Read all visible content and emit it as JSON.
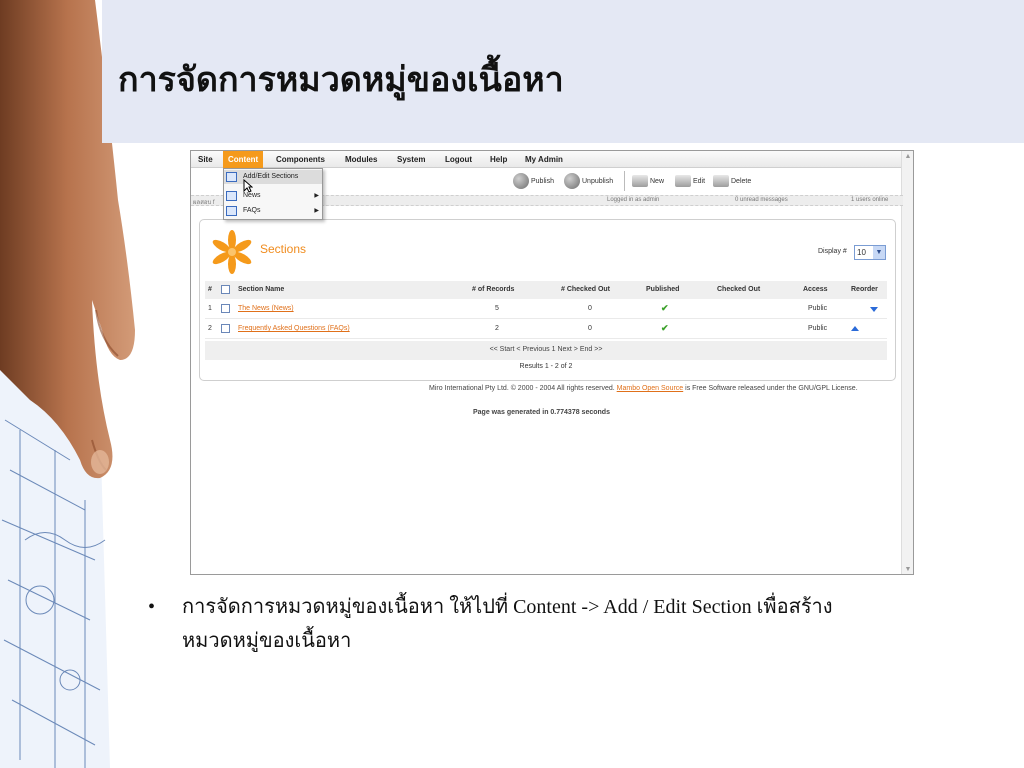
{
  "slide": {
    "title": "การจัดการหมวดหมู่ของเนื้อหา",
    "bullet": "•",
    "body_line1": "การจัดการหมวดหมู่ของเนื้อหา ให้ไปที่ Content -> Add / Edit Section เพื่อสร้าง",
    "body_line2": "หมวดหมู่ของเนื้อหา"
  },
  "app": {
    "menu": [
      "Site",
      "Content",
      "Components",
      "Modules",
      "System",
      "Logout",
      "Help",
      "My Admin"
    ],
    "active_menu": "Content",
    "dropdown": [
      "Add/Edit Sections",
      "News",
      "FAQs"
    ],
    "toolbar": {
      "publish": "Publish",
      "unpublish": "Unpublish",
      "new": "New",
      "edit": "Edit",
      "delete": "Delete"
    },
    "status": {
      "left": "ผลสอบ f",
      "logged": "Logged in as admin",
      "messages": "0 unread messages",
      "online": "1 users online"
    },
    "sections": {
      "title": "Sections",
      "display_label": "Display #",
      "display_value": "10",
      "columns": [
        "#",
        "Section Name",
        "# of Records",
        "# Checked Out",
        "Published",
        "Checked Out",
        "Access",
        "Reorder"
      ],
      "rows": [
        {
          "num": "1",
          "name": "The News (News)",
          "records": "5",
          "checked_out": "0",
          "published": "✔",
          "checked_by": "",
          "access": "Public",
          "reorder": "down"
        },
        {
          "num": "2",
          "name": "Frequently Asked Questions (FAQs)",
          "records": "2",
          "checked_out": "0",
          "published": "✔",
          "checked_by": "",
          "access": "Public",
          "reorder": "up"
        }
      ],
      "pagination": "<< Start < Previous 1 Next > End >>",
      "results": "Results 1 - 2 of 2"
    },
    "footer": {
      "copyright_pre": "Miro International Pty Ltd. © 2000 - 2004 All rights reserved.",
      "link": "Mambo Open Source",
      "copyright_post": "is Free Software released under the GNU/GPL License.",
      "generated": "Page was generated in 0.774378 seconds"
    }
  },
  "colors": {
    "title_band": "#e4e8f4",
    "menu_active": "#f59a1b",
    "section_title": "#f08c1e",
    "link": "#e0701a",
    "published_check": "#3ba12a"
  }
}
